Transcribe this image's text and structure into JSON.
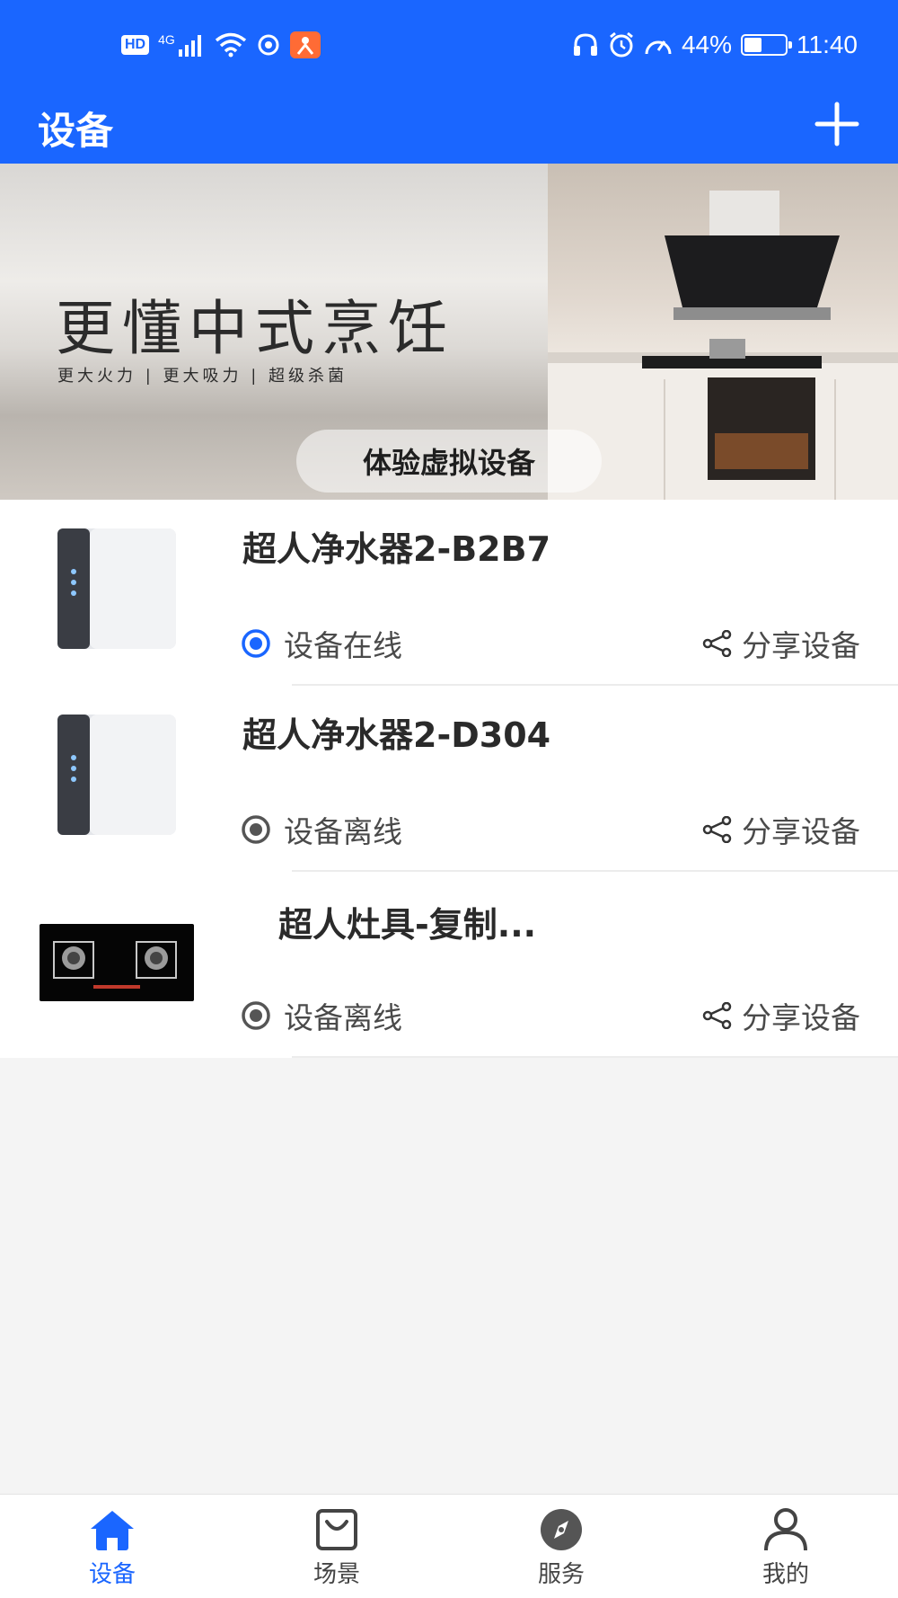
{
  "status_bar": {
    "hd": "HD",
    "network": "4G",
    "battery": "44%",
    "battery_level": 0.44,
    "time": "11:40"
  },
  "header": {
    "title": "设备",
    "add_icon": "plus-icon"
  },
  "banner": {
    "headline": "更懂中式烹饪",
    "subline": "更大火力 | 更大吸力 | 超级杀菌",
    "button_label": "体验虚拟设备"
  },
  "devices": [
    {
      "name": "超人净水器2-B2B7",
      "status": "设备在线",
      "online": true,
      "share_label": "分享设备",
      "thumb": "water-purifier"
    },
    {
      "name": "超人净水器2-D304",
      "status": "设备离线",
      "online": false,
      "share_label": "分享设备",
      "thumb": "water-purifier"
    },
    {
      "name": "超人灶具-复制...",
      "status": "设备离线",
      "online": false,
      "share_label": "分享设备",
      "thumb": "gas-stove"
    }
  ],
  "tabs": [
    {
      "label": "设备",
      "icon": "home-icon",
      "active": true
    },
    {
      "label": "场景",
      "icon": "bag-icon",
      "active": false
    },
    {
      "label": "服务",
      "icon": "compass-icon",
      "active": false
    },
    {
      "label": "我的",
      "icon": "user-icon",
      "active": false
    }
  ],
  "colors": {
    "primary": "#1a66ff",
    "online": "#1a66ff",
    "offline": "#555555",
    "text": "#2a2a2a"
  }
}
